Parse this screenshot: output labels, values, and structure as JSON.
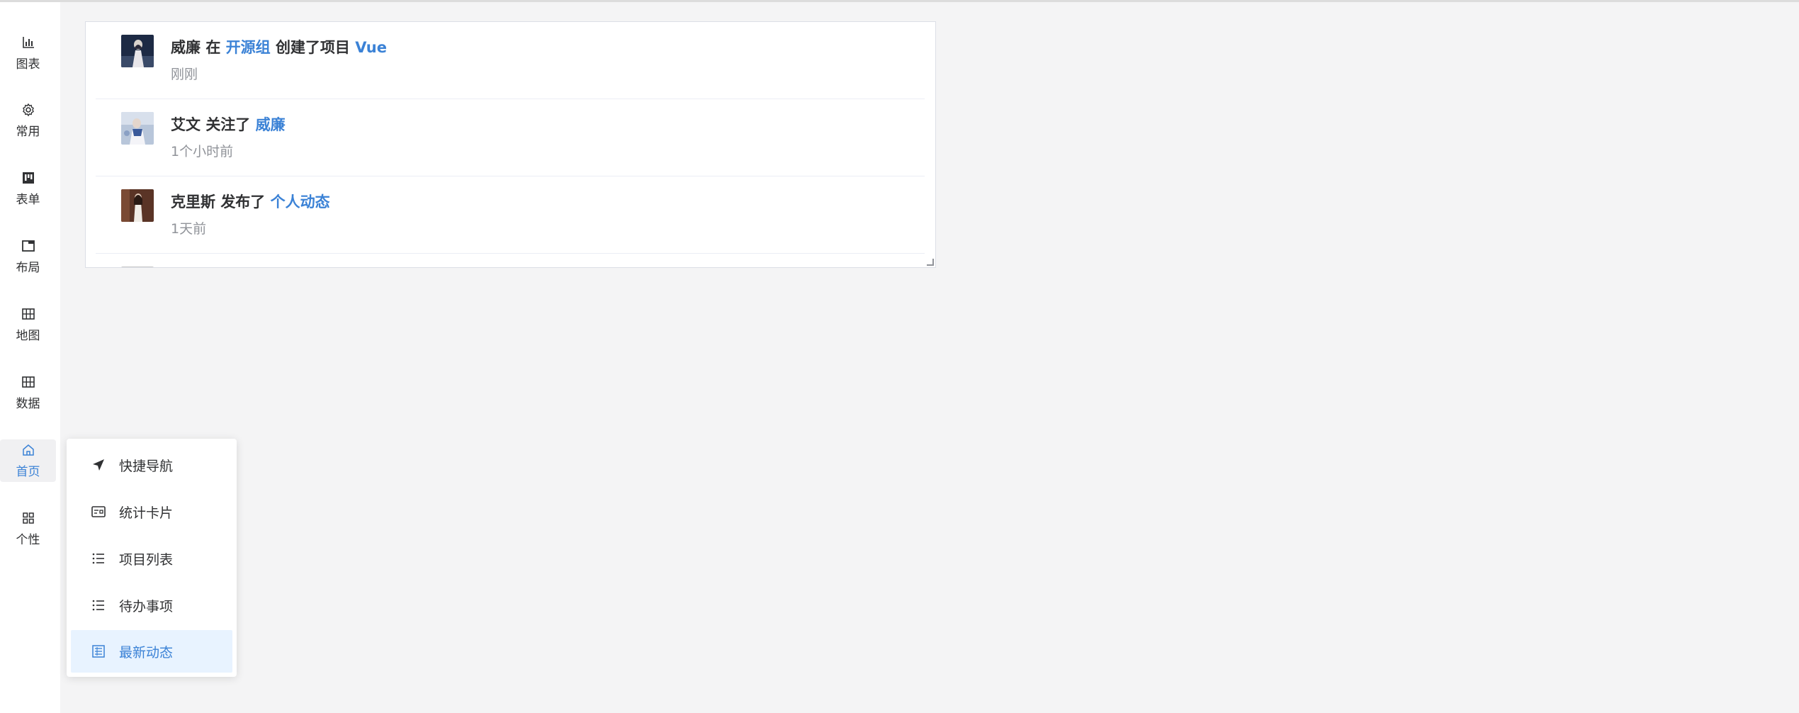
{
  "sidebar": {
    "items": [
      {
        "label": "图表",
        "icon": "bar-chart-icon"
      },
      {
        "label": "常用",
        "icon": "gear-icon"
      },
      {
        "label": "表单",
        "icon": "kanban-icon"
      },
      {
        "label": "布局",
        "icon": "folder-icon"
      },
      {
        "label": "地图",
        "icon": "grid-icon"
      },
      {
        "label": "数据",
        "icon": "table-icon"
      },
      {
        "label": "首页",
        "icon": "home-icon",
        "active": true
      },
      {
        "label": "个性",
        "icon": "apps-icon"
      }
    ]
  },
  "feed": {
    "items": [
      {
        "user": "威廉",
        "verb1": "在",
        "target1": "开源组",
        "verb2": "创建了项目",
        "target2": "Vue",
        "time": "刚刚"
      },
      {
        "user": "艾文",
        "verb1": "关注了",
        "target1": "威廉",
        "time": "1个小时前"
      },
      {
        "user": "克里斯",
        "verb1": "发布了",
        "target1": "个人动态",
        "time": "1天前"
      }
    ]
  },
  "popup": {
    "items": [
      {
        "label": "快捷导航",
        "icon": "send-icon"
      },
      {
        "label": "统计卡片",
        "icon": "card-icon"
      },
      {
        "label": "项目列表",
        "icon": "list-icon"
      },
      {
        "label": "待办事项",
        "icon": "list-icon"
      },
      {
        "label": "最新动态",
        "icon": "news-icon",
        "active": true
      }
    ]
  },
  "colors": {
    "accent": "#3b82d6",
    "background": "#f4f4f5",
    "active_item_bg": "#e8f3ff"
  }
}
